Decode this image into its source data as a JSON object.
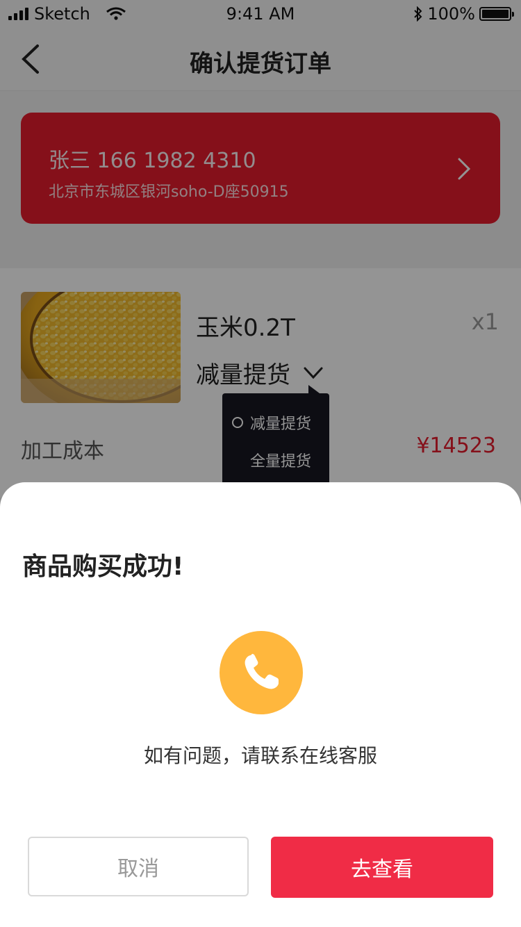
{
  "status_bar": {
    "carrier": "Sketch",
    "time": "9:41 AM",
    "battery": "100%"
  },
  "nav": {
    "title": "确认提货订单"
  },
  "address": {
    "name_phone": "张三  166 1982 4310",
    "address": "北京市东城区银河soho-D座50915"
  },
  "product": {
    "name": "玉米0.2T",
    "quantity": "x1",
    "mode": "减量提货",
    "cost_label": "加工成本",
    "cost_value": "¥14523"
  },
  "dropdown": {
    "options": [
      "减量提货",
      "全量提货"
    ],
    "selected": "减量提货"
  },
  "modal": {
    "title": "商品购买成功!",
    "message": "如有问题，请联系在线客服",
    "cancel_label": "取消",
    "view_label": "去查看"
  },
  "colors": {
    "brand_red": "#e61c2e",
    "button_red": "#f02c46",
    "phone_yellow": "#ffb73d",
    "dropdown_bg": "#171722"
  }
}
